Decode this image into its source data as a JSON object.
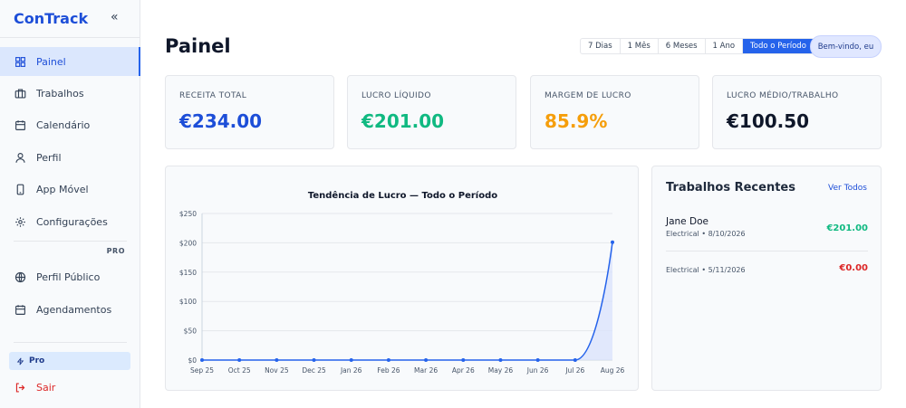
{
  "app": {
    "brand": "ConTrack",
    "collapse_icon": "«"
  },
  "sidebar": {
    "items": [
      {
        "label": "Painel",
        "icon": "dashboard-icon",
        "active": true
      },
      {
        "label": "Trabalhos",
        "icon": "briefcase-icon"
      },
      {
        "label": "Calendário",
        "icon": "calendar-icon"
      },
      {
        "label": "Perfil",
        "icon": "user-icon"
      },
      {
        "label": "App Móvel",
        "icon": "smartphone-icon"
      },
      {
        "label": "Configurações",
        "icon": "gear-icon"
      }
    ],
    "pro_section_label": "PRO",
    "pro_items": [
      {
        "label": "Perfil Público",
        "icon": "globe-icon"
      },
      {
        "label": "Agendamentos",
        "icon": "calendar-icon"
      }
    ],
    "pro_badge": "Pro",
    "logout": "Sair"
  },
  "header": {
    "title": "Painel",
    "ranges": [
      "7 Dias",
      "1 Mês",
      "6 Meses",
      "1 Ano",
      "Todo o Período"
    ],
    "active_range": "Todo o Período",
    "welcome": "Bem-vindo, eu"
  },
  "stats": [
    {
      "label": "RECEITA TOTAL",
      "value": "€234.00",
      "color": "#1d4ed8"
    },
    {
      "label": "LUCRO LÍQUIDO",
      "value": "€201.00",
      "color": "#10b981"
    },
    {
      "label": "MARGEM DE LUCRO",
      "value": "85.9%",
      "color": "#f59e0b"
    },
    {
      "label": "LUCRO MÉDIO/TRABALHO",
      "value": "€100.50",
      "color": "#0f172a"
    }
  ],
  "chart_data": {
    "type": "area",
    "title": "Tendência de Lucro — Todo o Período",
    "categories": [
      "Sep 25",
      "Oct 25",
      "Nov 25",
      "Dec 25",
      "Jan 26",
      "Feb 26",
      "Mar 26",
      "Apr 26",
      "May 26",
      "Jun 26",
      "Jul 26",
      "Aug 26"
    ],
    "values": [
      0,
      0,
      0,
      0,
      0,
      0,
      0,
      0,
      0,
      0,
      0,
      201
    ],
    "y_ticks": [
      "$0",
      "$50",
      "$100",
      "$150",
      "$200",
      "$250"
    ],
    "ylim": [
      0,
      250
    ],
    "grid": true,
    "line_color": "#2563eb",
    "fill_color": "#dbe4fb"
  },
  "recent": {
    "title": "Trabalhos Recentes",
    "view_all": "Ver Todos",
    "jobs": [
      {
        "name": "Jane Doe",
        "meta": "Electrical • 8/10/2026",
        "amount": "€201.00",
        "amount_color": "#10b981"
      },
      {
        "name": "",
        "meta": "Electrical • 5/11/2026",
        "amount": "€0.00",
        "amount_color": "#dc2626"
      }
    ]
  }
}
